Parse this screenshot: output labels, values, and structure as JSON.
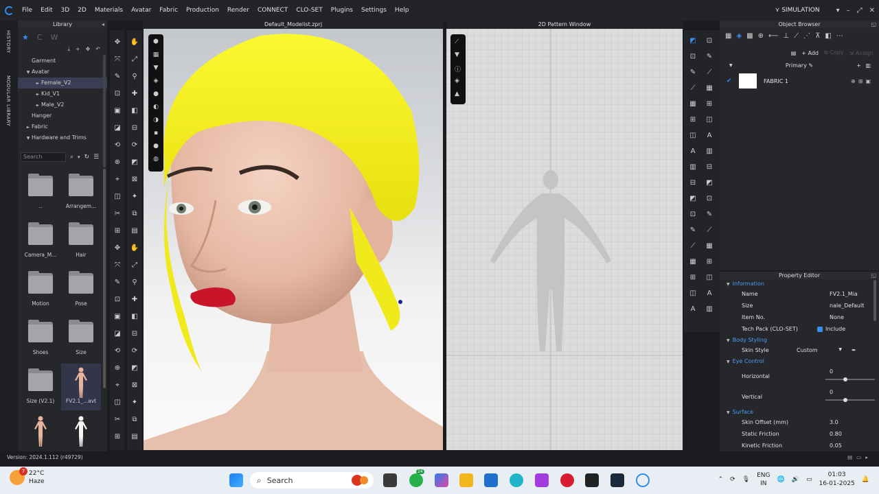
{
  "menu": [
    "File",
    "Edit",
    "3D",
    "2D",
    "Materials",
    "Avatar",
    "Fabric",
    "Production",
    "Render",
    "CONNECT",
    "CLO-SET",
    "Plugins",
    "Settings",
    "Help"
  ],
  "mode": "SIMULATION",
  "vtabs": [
    "HISTORY",
    "MODULAR LIBRARY"
  ],
  "library": {
    "title": "Library",
    "tree": [
      {
        "label": "Garment",
        "level": 0,
        "arrow": ""
      },
      {
        "label": "Avatar",
        "level": 0,
        "arrow": "▼"
      },
      {
        "label": "Female_V2",
        "level": 1,
        "arrow": "►",
        "selected": true
      },
      {
        "label": "Kid_V1",
        "level": 1,
        "arrow": "►"
      },
      {
        "label": "Male_V2",
        "level": 1,
        "arrow": "►"
      },
      {
        "label": "Hanger",
        "level": 0,
        "arrow": ""
      },
      {
        "label": "Fabric",
        "level": 0,
        "arrow": "►"
      },
      {
        "label": "Hardware and Trims",
        "level": 0,
        "arrow": "▼"
      }
    ],
    "search_placeholder": "Search",
    "grid": [
      {
        "label": "..",
        "kind": "folder"
      },
      {
        "label": "Arrangem...",
        "kind": "folder"
      },
      {
        "label": "Camera_M...",
        "kind": "folder"
      },
      {
        "label": "Hair",
        "kind": "folder"
      },
      {
        "label": "Motion",
        "kind": "folder"
      },
      {
        "label": "Pose",
        "kind": "folder"
      },
      {
        "label": "Shoes",
        "kind": "folder"
      },
      {
        "label": "Size",
        "kind": "folder"
      },
      {
        "label": "Size (V2.1)",
        "kind": "folder"
      },
      {
        "label": "FV2.1_...avt",
        "kind": "avatar",
        "selected": true
      },
      {
        "label": "",
        "kind": "avatar"
      },
      {
        "label": "",
        "kind": "avatar-white"
      }
    ]
  },
  "window3d_title": "Default_Modelist.zprj",
  "window2d_title": "2D Pattern Window",
  "object_browser": {
    "title": "Object Browser",
    "add_label": "Add",
    "copy_label": "Copy",
    "assign_label": "Assign",
    "primary_label": "Primary",
    "fabric_name": "FABRIC 1"
  },
  "property_editor": {
    "title": "Property Editor",
    "information": "Information",
    "name_label": "Name",
    "name_value": "FV2.1_Mia",
    "size_label": "Size",
    "size_value": "nale_Default",
    "item_label": "Item No.",
    "item_value": "None",
    "techpack_label": "Tech Pack (CLO-SET)",
    "techpack_value": "Include",
    "body_styling": "Body Styling",
    "skin_style_label": "Skin Style",
    "skin_style_value": "Custom",
    "eye_control": "Eye Control",
    "horizontal_label": "Horizontal",
    "horizontal_value": "0",
    "vertical_label": "Vertical",
    "vertical_value": "0",
    "surface": "Surface",
    "skin_offset_label": "Skin Offset (mm)",
    "skin_offset_value": "3.0",
    "static_friction_label": "Static Friction",
    "static_friction_value": "0.80",
    "kinetic_friction_label": "Kinetic Friction",
    "kinetic_friction_value": "0.05"
  },
  "version": "Version: 2024.1.112 (r49729)",
  "taskbar": {
    "weather_temp": "22°C",
    "weather_desc": "Haze",
    "weather_badge": "7",
    "search_label": "Search",
    "whatsapp_badge": "24",
    "lang_top": "ENG",
    "lang_bottom": "IN",
    "time": "01:03",
    "date": "16-01-2025"
  },
  "colors": {
    "accent": "#2f8ee8",
    "hair": "#f2ef1a",
    "lips": "#c8152a"
  }
}
